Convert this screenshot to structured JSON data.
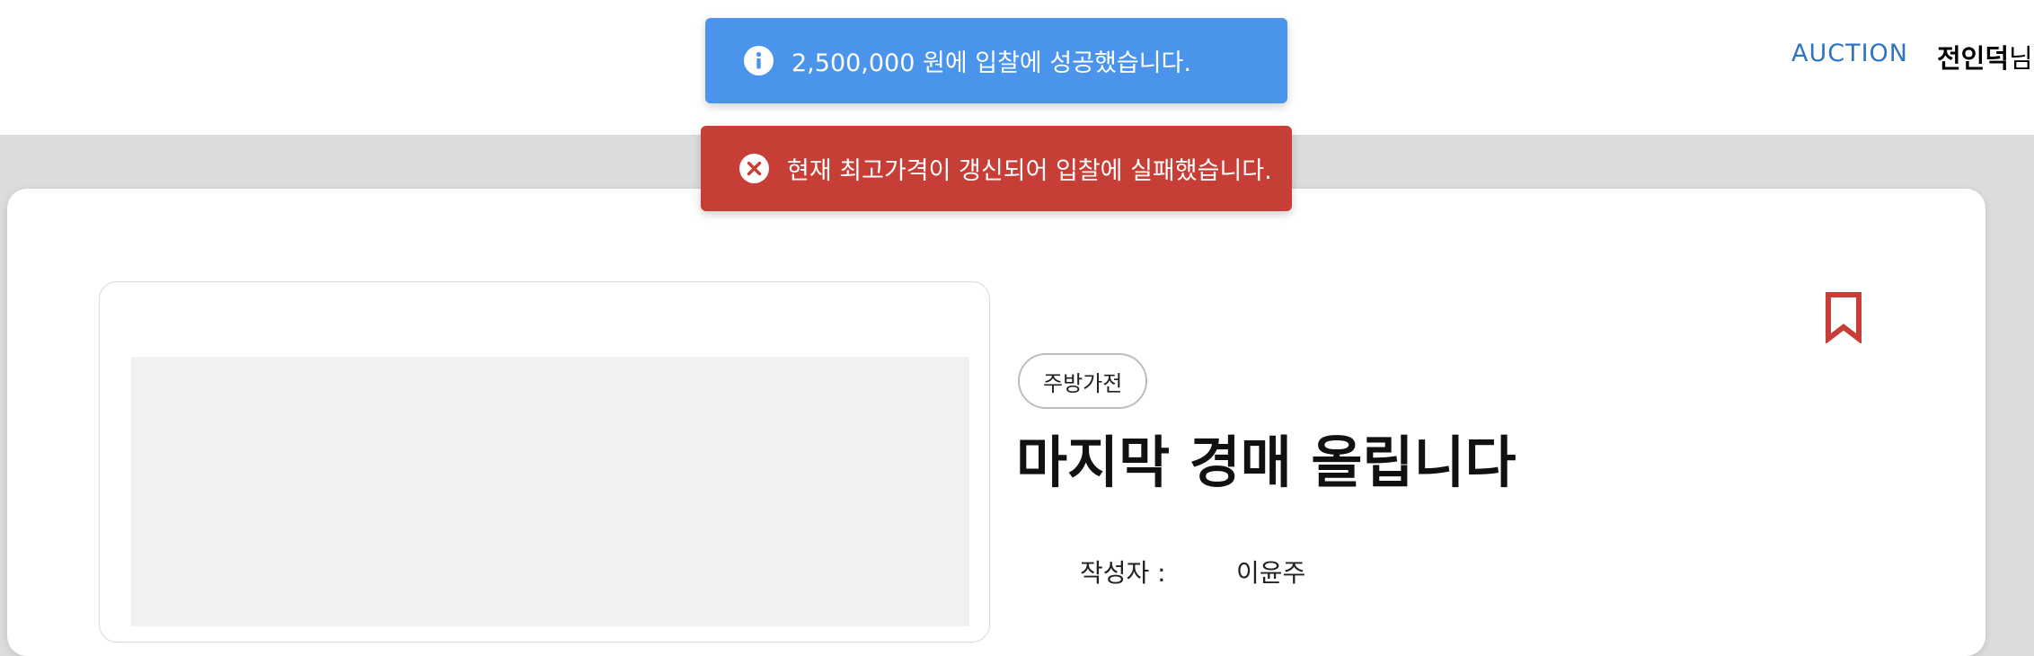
{
  "header": {
    "nav_auction": "AUCTION",
    "user_name": "전인덕",
    "user_suffix": "님"
  },
  "toasts": {
    "success": {
      "icon": "info-icon",
      "message": "2,500,000 원에 입찰에 성공했습니다.",
      "color": "#4a94ec"
    },
    "error": {
      "icon": "close-circle-icon",
      "message": "현재 최고가격이 갱신되어 입찰에 실패했습니다.",
      "color": "#c73e36"
    }
  },
  "item": {
    "category": "주방가전",
    "title": "마지막 경매 올립니다",
    "author_label": "작성자 :",
    "author_value": "이윤주",
    "bookmark_color": "#c73e36"
  }
}
